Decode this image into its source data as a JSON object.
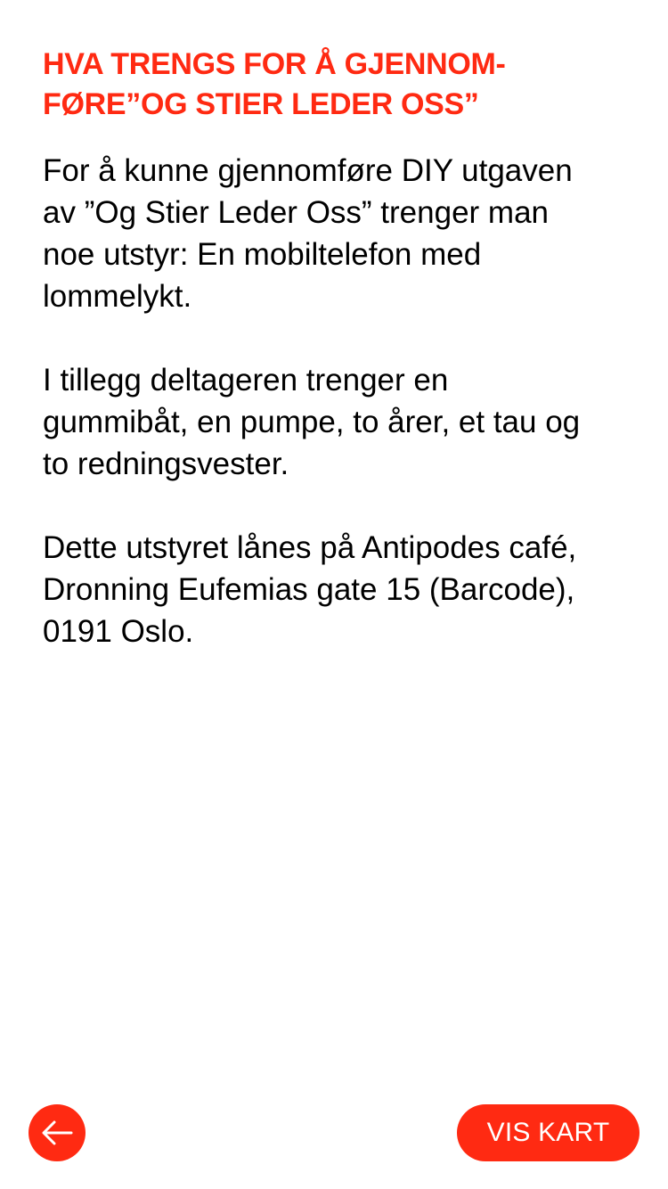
{
  "header": {
    "title_lines": [
      "HVA TRENGS FOR Å GJENNOM-",
      "FØRE”OG STIER LEDER OSS”"
    ]
  },
  "body": {
    "paragraphs": [
      {
        "lines": [
          "For å kunne gjennomføre DIY utgaven",
          "av ”Og Stier Leder Oss” trenger man",
          "noe utstyr: En mobiltelefon med",
          "lommelykt."
        ]
      },
      {
        "lines": [
          "I tillegg deltageren trenger en",
          "gummibåt, en pumpe, to årer, et tau og",
          "to redningsvester."
        ]
      },
      {
        "lines": [
          "Dette utstyret lånes på Antipodes café,",
          "Dronning Eufemias gate 15 (Barcode),",
          "0191 Oslo."
        ]
      }
    ]
  },
  "footer": {
    "back_icon": "arrow-left-icon",
    "map_button_label": "VIS KART"
  },
  "colors": {
    "accent": "#ff2a12",
    "text": "#000000",
    "background": "#ffffff"
  }
}
